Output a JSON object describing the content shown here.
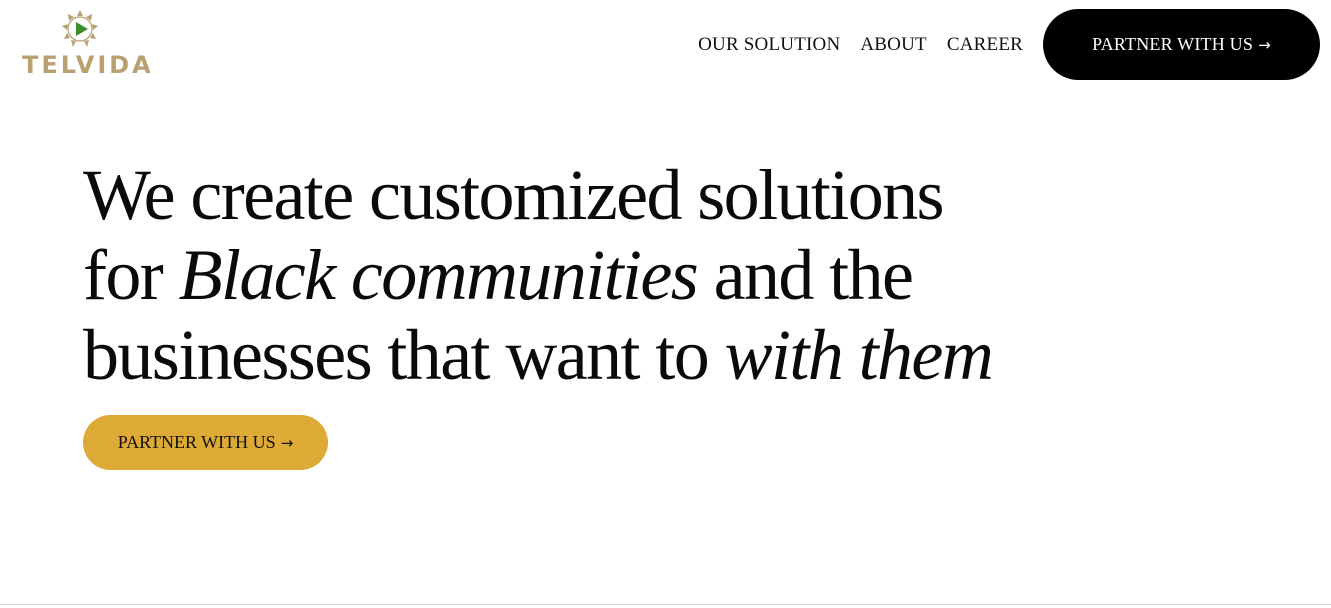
{
  "brand": {
    "name": "TELVIDA",
    "logo_icon": "telvida-star-play-icon",
    "gold_color": "#b8a070",
    "play_color": "#3f8d2e"
  },
  "nav": {
    "links": [
      {
        "label": "OUR SOLUTION"
      },
      {
        "label": "ABOUT"
      },
      {
        "label": "CAREER"
      }
    ],
    "cta_label": "PARTNER WITH US",
    "cta_arrow": "→",
    "cta_color": "#000000"
  },
  "hero": {
    "line1": "We create customized solutions",
    "line2_prefix": "for ",
    "line2_emphasis": "Black communities",
    "line2_suffix": " and the",
    "line3_prefix": "businesses that want to ",
    "line3_emphasis": "with them",
    "cta_label": "PARTNER WITH US",
    "cta_arrow": "→",
    "cta_color": "#ddaa35"
  }
}
